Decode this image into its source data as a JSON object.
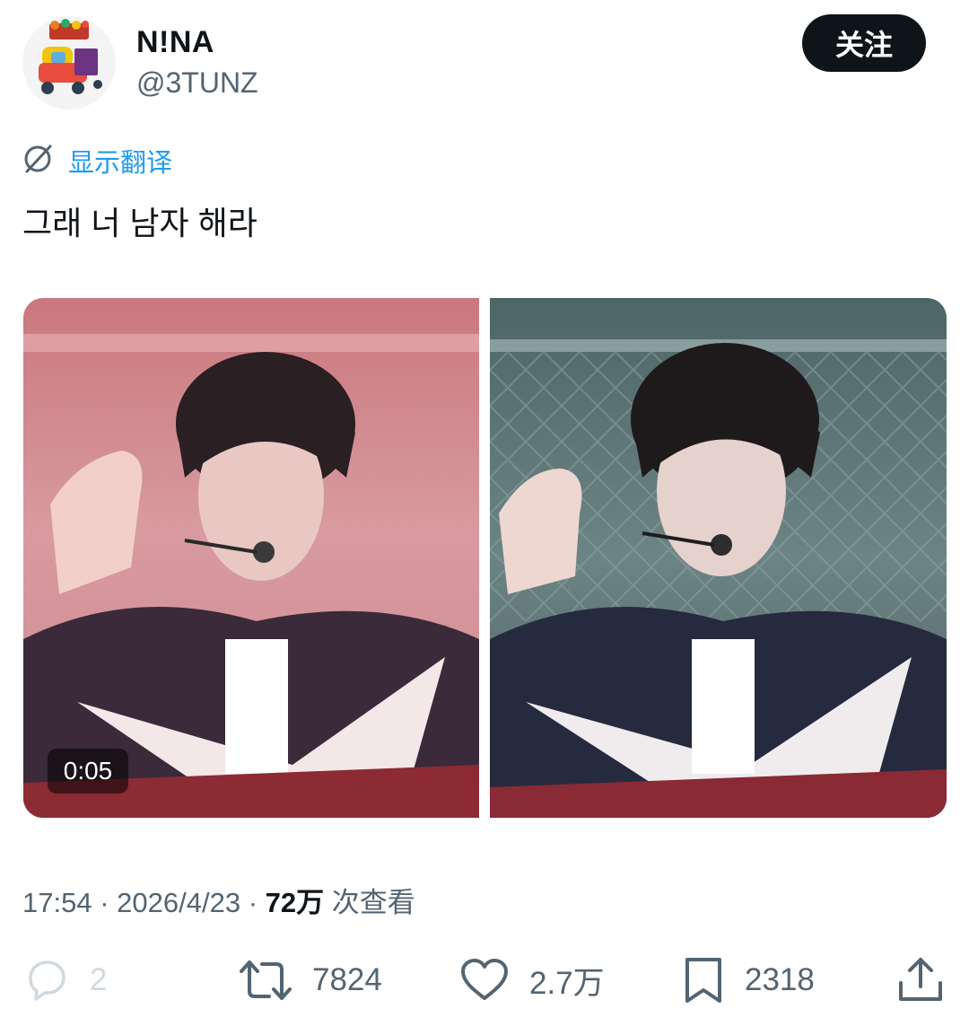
{
  "user": {
    "display_name": "N!NA",
    "handle": "@3TUNZ",
    "avatar": "avatar-image"
  },
  "header": {
    "follow_label": "关注"
  },
  "translate": {
    "label": "显示翻译",
    "icon": "translate-icon"
  },
  "tweet": {
    "text": "그래 너 남자 해라"
  },
  "media": {
    "video_duration": "0:05",
    "left_tint": "#c9787d",
    "right_tint": "#5e7272"
  },
  "meta": {
    "time": "17:54",
    "separator": "·",
    "date": "2026/4/23",
    "views": "72万",
    "views_label": "次查看"
  },
  "actions": {
    "reply_count": "2",
    "retweet_count": "7824",
    "like_count": "2.7万",
    "bookmark_count": "2318"
  },
  "colors": {
    "text_primary": "#0f1419",
    "text_secondary": "#536471",
    "link": "#1d9bf0",
    "button_bg": "#0f1419"
  }
}
